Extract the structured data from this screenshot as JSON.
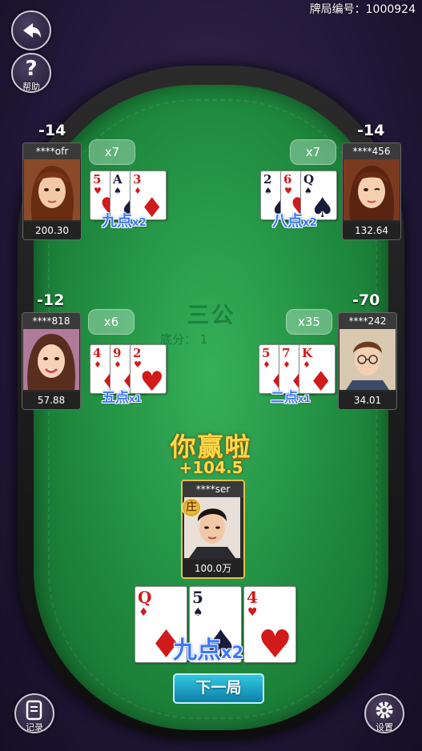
{
  "header": {
    "hand_id": "牌局编号：1000924"
  },
  "buttons": {
    "back_label": "",
    "help_label": "帮助",
    "record_label": "记录",
    "settings_label": "设置"
  },
  "table": {
    "game_title": "三公",
    "base_score_label": "底分： 1"
  },
  "players": [
    {
      "name": "****ofr",
      "score_change": "-14",
      "balance": "200.30",
      "bet": "x7",
      "result_name": "九点",
      "result_mult": "x2",
      "cards": [
        {
          "rank": "5",
          "suit": "heart"
        },
        {
          "rank": "A",
          "suit": "spade"
        },
        {
          "rank": "3",
          "suit": "diamond"
        }
      ]
    },
    {
      "name": "****456",
      "score_change": "-14",
      "balance": "132.64",
      "bet": "x7",
      "result_name": "八点",
      "result_mult": "x2",
      "cards": [
        {
          "rank": "2",
          "suit": "spade"
        },
        {
          "rank": "6",
          "suit": "heart"
        },
        {
          "rank": "Q",
          "suit": "spade"
        }
      ]
    },
    {
      "name": "****818",
      "score_change": "-12",
      "balance": "57.88",
      "bet": "x6",
      "result_name": "五点",
      "result_mult": "x1",
      "cards": [
        {
          "rank": "4",
          "suit": "diamond"
        },
        {
          "rank": "9",
          "suit": "diamond"
        },
        {
          "rank": "2",
          "suit": "heart"
        }
      ]
    },
    {
      "name": "****242",
      "score_change": "-70",
      "balance": "34.01",
      "bet": "x35",
      "result_name": "二点",
      "result_mult": "x1",
      "cards": [
        {
          "rank": "5",
          "suit": "diamond"
        },
        {
          "rank": "7",
          "suit": "diamond"
        },
        {
          "rank": "K",
          "suit": "diamond"
        }
      ]
    }
  ],
  "self": {
    "name": "****ser",
    "balance": "100.0万",
    "banker_badge": "庄",
    "win_text": "你赢啦",
    "win_amount": "+104.5",
    "result_name": "九点",
    "result_mult": "x2",
    "cards": [
      {
        "rank": "Q",
        "suit": "diamond"
      },
      {
        "rank": "5",
        "suit": "spade"
      },
      {
        "rank": "4",
        "suit": "heart"
      }
    ]
  },
  "next_button": "下一局",
  "colors": {
    "felt": "#1f8a3e",
    "gold": "#ffd84a",
    "result_blue": "#3d77ff",
    "next_button": "#1ea3c8"
  }
}
